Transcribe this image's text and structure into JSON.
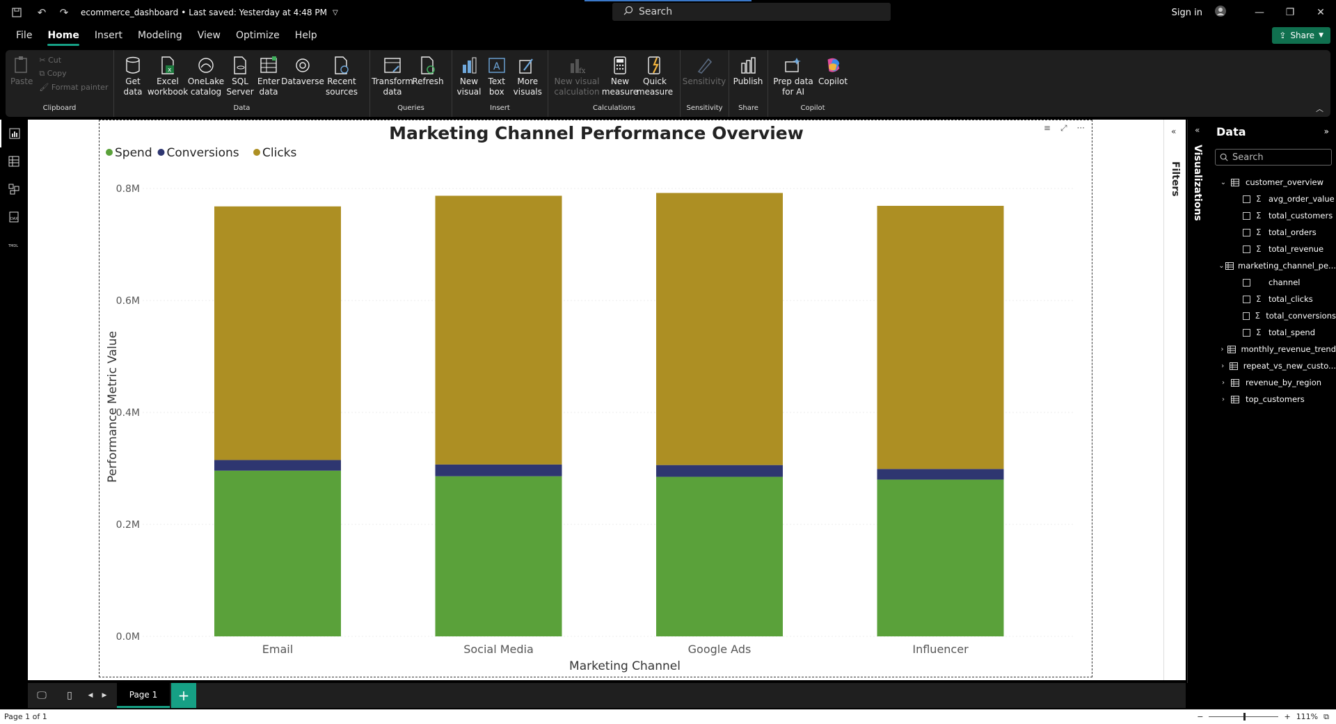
{
  "titlebar": {
    "file_name": "ecommerce_dashboard",
    "saved_status": "Last saved: Yesterday at 4:48 PM",
    "search_placeholder": "Search",
    "signin": "Sign in"
  },
  "menu": {
    "tabs": [
      "File",
      "Home",
      "Insert",
      "Modeling",
      "View",
      "Optimize",
      "Help"
    ],
    "active_tab": "Home",
    "share_label": "Share"
  },
  "ribbon": {
    "clipboard": {
      "paste": "Paste",
      "cut": "Cut",
      "copy": "Copy",
      "format_painter": "Format painter",
      "label": "Clipboard"
    },
    "data": {
      "get_data": "Get data",
      "excel": "Excel workbook",
      "onelake": "OneLake catalog",
      "sql": "SQL Server",
      "enter_data": "Enter data",
      "dataverse": "Dataverse",
      "recent": "Recent sources",
      "label": "Data"
    },
    "queries": {
      "transform": "Transform data",
      "refresh": "Refresh",
      "label": "Queries"
    },
    "insert": {
      "new_visual": "New visual",
      "text_box": "Text box",
      "more_visuals": "More visuals",
      "label": "Insert"
    },
    "calculations": {
      "new_visual_calc": "New visual calculation",
      "new_measure": "New measure",
      "quick_measure": "Quick measure",
      "label": "Calculations"
    },
    "sensitivity": {
      "sensitivity": "Sensitivity",
      "label": "Sensitivity"
    },
    "share": {
      "publish": "Publish",
      "label": "Share"
    },
    "copilot": {
      "prep_data": "Prep data for AI",
      "copilot": "Copilot",
      "label": "Copilot"
    }
  },
  "panes": {
    "filters_label": "Filters",
    "visualizations_label": "Visualizations",
    "data_title": "Data",
    "data_search_placeholder": "Search"
  },
  "data_tree": [
    {
      "name": "customer_overview",
      "expanded": true,
      "fields": [
        {
          "name": "avg_order_value",
          "sigma": true
        },
        {
          "name": "total_customers",
          "sigma": true
        },
        {
          "name": "total_orders",
          "sigma": true
        },
        {
          "name": "total_revenue",
          "sigma": true
        }
      ]
    },
    {
      "name": "marketing_channel_pe...",
      "expanded": true,
      "fields": [
        {
          "name": "channel",
          "sigma": false
        },
        {
          "name": "total_clicks",
          "sigma": true
        },
        {
          "name": "total_conversions",
          "sigma": true
        },
        {
          "name": "total_spend",
          "sigma": true
        }
      ]
    },
    {
      "name": "monthly_revenue_trend",
      "expanded": false,
      "fields": []
    },
    {
      "name": "repeat_vs_new_custo...",
      "expanded": false,
      "fields": []
    },
    {
      "name": "revenue_by_region",
      "expanded": false,
      "fields": []
    },
    {
      "name": "top_customers",
      "expanded": false,
      "fields": []
    }
  ],
  "pages": {
    "tab": "Page 1",
    "status": "Page 1 of 1",
    "zoom": "111%"
  },
  "chart_data": {
    "type": "bar",
    "stacked": true,
    "title": "Marketing Channel Performance Overview",
    "xlabel": "Marketing Channel",
    "ylabel": "Performance Metric Value",
    "categories": [
      "Email",
      "Social Media",
      "Google Ads",
      "Influencer"
    ],
    "series": [
      {
        "name": "Spend",
        "color": "#5aa13a",
        "values": [
          296000,
          286000,
          285000,
          280000
        ]
      },
      {
        "name": "Conversions",
        "color": "#2e3670",
        "values": [
          19000,
          21000,
          21000,
          19000
        ]
      },
      {
        "name": "Clicks",
        "color": "#ad8f23",
        "values": [
          453000,
          480000,
          486000,
          470000
        ]
      }
    ],
    "ylim": [
      0,
      800000
    ],
    "yticks": [
      "0.0M",
      "0.2M",
      "0.4M",
      "0.6M",
      "0.8M"
    ],
    "legend_position": "top-left",
    "grid": true
  }
}
